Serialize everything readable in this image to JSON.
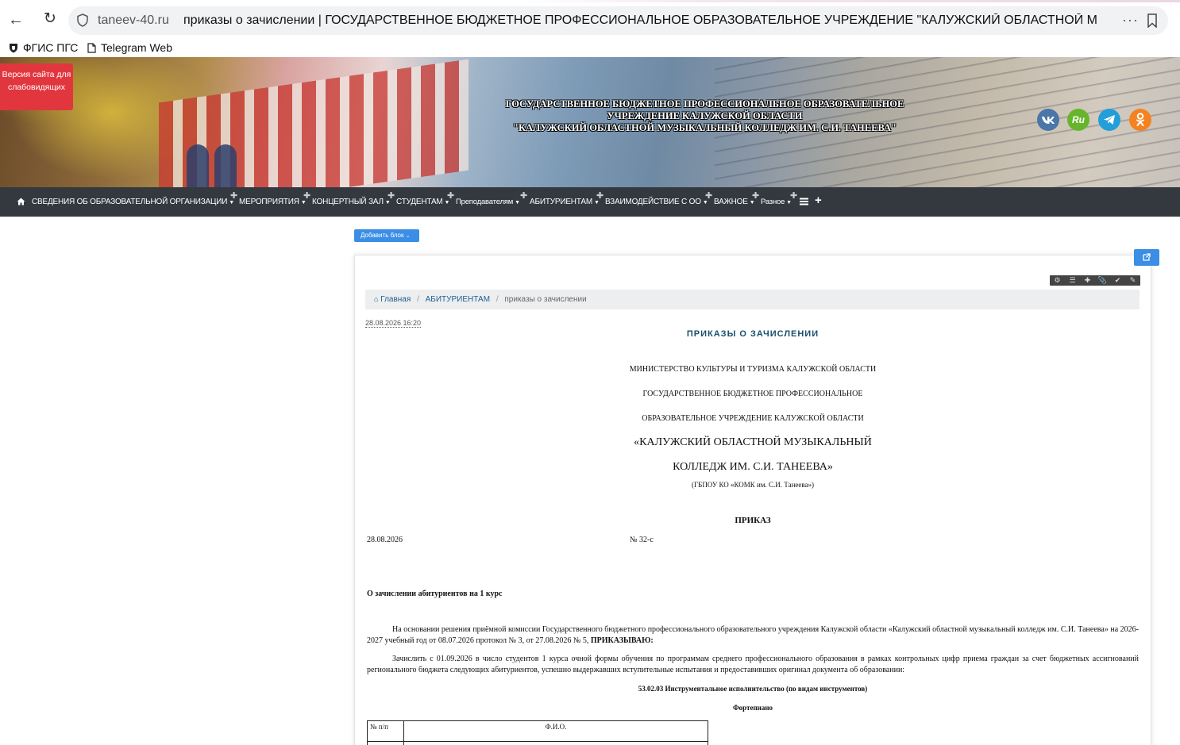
{
  "browser": {
    "url_host": "taneev-40.ru",
    "tab_title": "приказы о зачислении | ГОСУДАРСТВЕННОЕ БЮДЖЕТНОЕ ПРОФЕССИОНАЛЬНОЕ ОБРАЗОВАТЕЛЬНОЕ УЧРЕЖДЕНИЕ \"КАЛУЖСКИЙ ОБЛАСТНОЙ МУЗЫКАЛЬ...",
    "more_label": "···"
  },
  "bookmarks": [
    {
      "label": "ФГИС ПГС"
    },
    {
      "label": "Telegram Web"
    }
  ],
  "header": {
    "lowvision_label": "Версия сайта для слабовидящих",
    "title_line1": "ГОСУДАРСТВЕННОЕ БЮДЖЕТНОЕ ПРОФЕССИОНАЛЬНОЕ ОБРАЗОВАТЕЛЬНОЕ",
    "title_line2": "УЧРЕЖДЕНИЕ КАЛУЖСКОЙ ОБЛАСТИ",
    "title_line3": "\"КАЛУЖСКИЙ ОБЛАСТНОЙ МУЗЫКАЛЬНЫЙ КОЛЛЕДЖ ИМ. С.И. ТАНЕЕВА\"",
    "social": {
      "vk": "vk",
      "ru": "Ru",
      "tg": "telegram",
      "ok": "ok"
    }
  },
  "nav": {
    "items": [
      {
        "label": "СВЕДЕНИЯ ОБ ОБРАЗОВАТЕЛЬНОЙ ОРГАНИЗАЦИИ"
      },
      {
        "label": "МЕРОПРИЯТИЯ"
      },
      {
        "label": "КОНЦЕРТНЫЙ ЗАЛ"
      },
      {
        "label": "СТУДЕНТАМ"
      },
      {
        "label": "Преподавателям"
      },
      {
        "label": "АБИТУРИЕНТАМ"
      },
      {
        "label": "ВЗАИМОДЕЙСТВИЕ С ОО"
      },
      {
        "label": "ВАЖНОЕ"
      },
      {
        "label": "Разное"
      }
    ]
  },
  "content": {
    "add_block_label": "Добавить блок",
    "breadcrumb": {
      "home": "Главная",
      "section": "АБИТУРИЕНТАМ",
      "current": "приказы о зачислении",
      "sep": "/"
    },
    "date_stamp": "28.08.2026 16:20",
    "page_title": "ПРИКАЗЫ О ЗАЧИСЛЕНИИ",
    "doc": {
      "ministry": "МИНИСТЕРСТВО КУЛЬТУРЫ И ТУРИЗМА КАЛУЖСКОЙ ОБЛАСТИ",
      "org_line1": "ГОСУДАРСТВЕННОЕ БЮДЖЕТНОЕ ПРОФЕССИОНАЛЬНОЕ",
      "org_line2": "ОБРАЗОВАТЕЛЬНОЕ УЧРЕЖДЕНИЕ КАЛУЖСКОЙ ОБЛАСТИ",
      "org_line3": "«КАЛУЖСКИЙ ОБЛАСТНОЙ МУЗЫКАЛЬНЫЙ",
      "org_line4": "КОЛЛЕДЖ ИМ. С.И. ТАНЕЕВА»",
      "org_short": "(ГБПОУ КО «КОМК им. С.И. Танеева»)",
      "order_heading": "ПРИКАЗ",
      "order_date": "28.08.2026",
      "order_number": "№  32-с",
      "subject": "О зачислении абитуриентов на 1 курс",
      "para1": "На основании решения приёмной комиссии Государственного бюджетного профессионального образовательного учреждения Калужской области «Калужский областной музыкальный колледж им. С.И. Танеева» на 2026-2027 учебный год от 08.07.2026 протокол № 3, от 27.08.2026 № 5,",
      "para1_bold": "ПРИКАЗЫВАЮ:",
      "para2": "Зачислить с 01.09.2026 в число студентов 1 курса очной формы обучения по программам среднего профессионального образования в рамках контрольных цифр приема граждан за счет бюджетных ассигнований регионального бюджета следующих абитуриентов, успешно выдержавших вступительные испытания и предоставивших оригинал документа об образовании:",
      "specialty": "53.02.03 Инструментальное исполнительство (по видам инструментов)",
      "instrument": "Фортепиано",
      "table_header": {
        "num": "№ п/п",
        "name": "Ф.И.О."
      }
    }
  }
}
